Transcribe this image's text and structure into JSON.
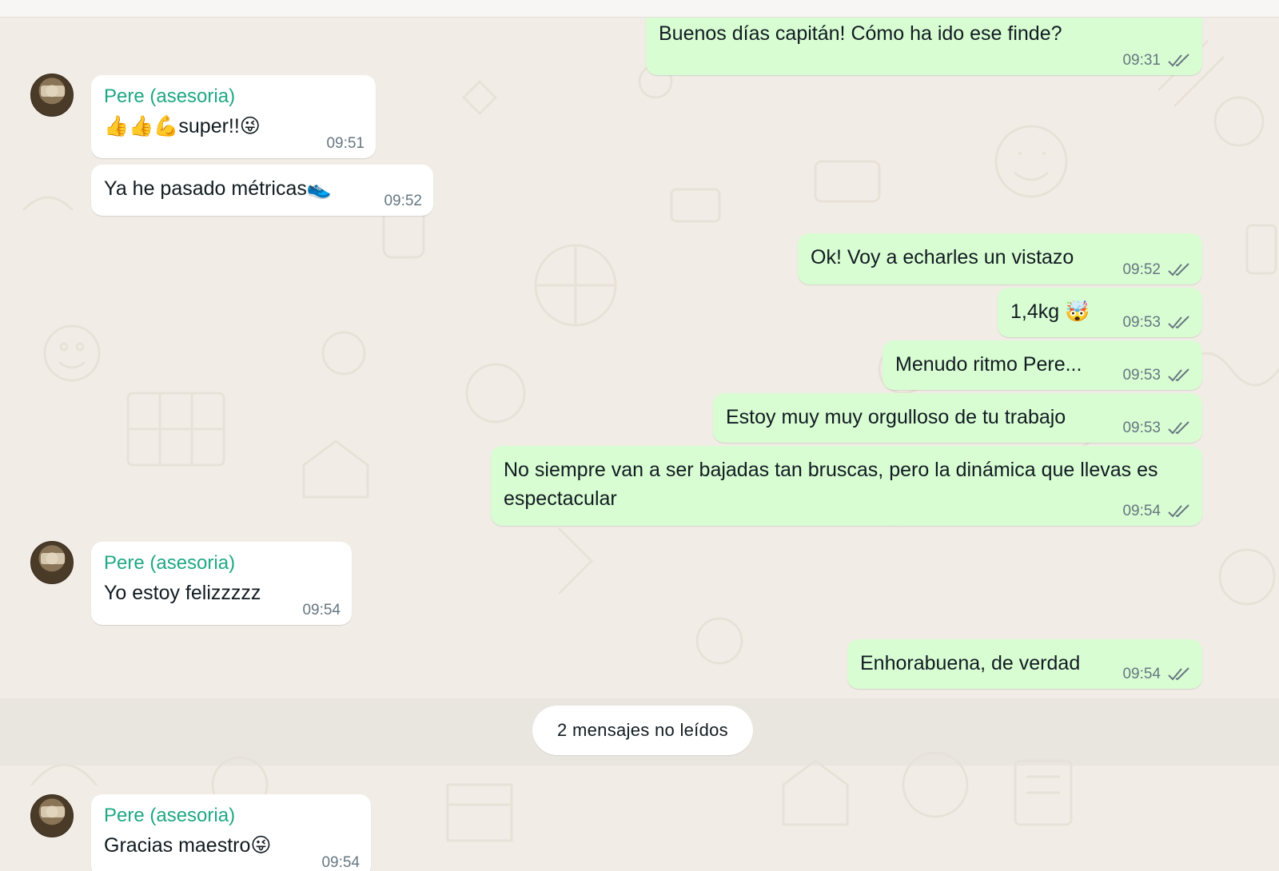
{
  "contact": {
    "name": "Pere (asesoria)"
  },
  "messages": [
    {
      "dir": "out",
      "text": "Buenos días capitán! Cómo ha ido ese finde?",
      "time": "09:31"
    },
    {
      "dir": "in",
      "sender": "Pere (asesoria)",
      "text": "👍👍💪super!!😜",
      "time": "09:51"
    },
    {
      "dir": "in",
      "text": "Ya he pasado métricas👟",
      "time": "09:52"
    },
    {
      "dir": "out",
      "text": "Ok! Voy a echarles un vistazo",
      "time": "09:52"
    },
    {
      "dir": "out",
      "text": "1,4kg 🤯",
      "time": "09:53"
    },
    {
      "dir": "out",
      "text": "Menudo ritmo Pere...",
      "time": "09:53"
    },
    {
      "dir": "out",
      "text": "Estoy muy muy orgulloso de tu trabajo",
      "time": "09:53"
    },
    {
      "dir": "out",
      "text": "No siempre van a ser bajadas tan bruscas, pero la dinámica que llevas es espectacular",
      "time": "09:54"
    },
    {
      "dir": "in",
      "sender": "Pere (asesoria)",
      "text": "Yo estoy felizzzzz",
      "time": "09:54"
    },
    {
      "dir": "out",
      "text": "Enhorabuena, de verdad",
      "time": "09:54"
    },
    {
      "dir": "in",
      "sender": "Pere (asesoria)",
      "text": "Gracias maestro😜",
      "time": "09:54"
    }
  ],
  "unread_banner": "2 mensajes no leídos",
  "colors": {
    "outgoing_bubble": "#d9fdd3",
    "incoming_bubble": "#ffffff",
    "sender_name": "#1fa885",
    "timestamp": "#667781",
    "chat_background": "#f1ede6"
  },
  "icons": {
    "read_receipt": "double-check-icon",
    "avatar": "contact-avatar"
  }
}
